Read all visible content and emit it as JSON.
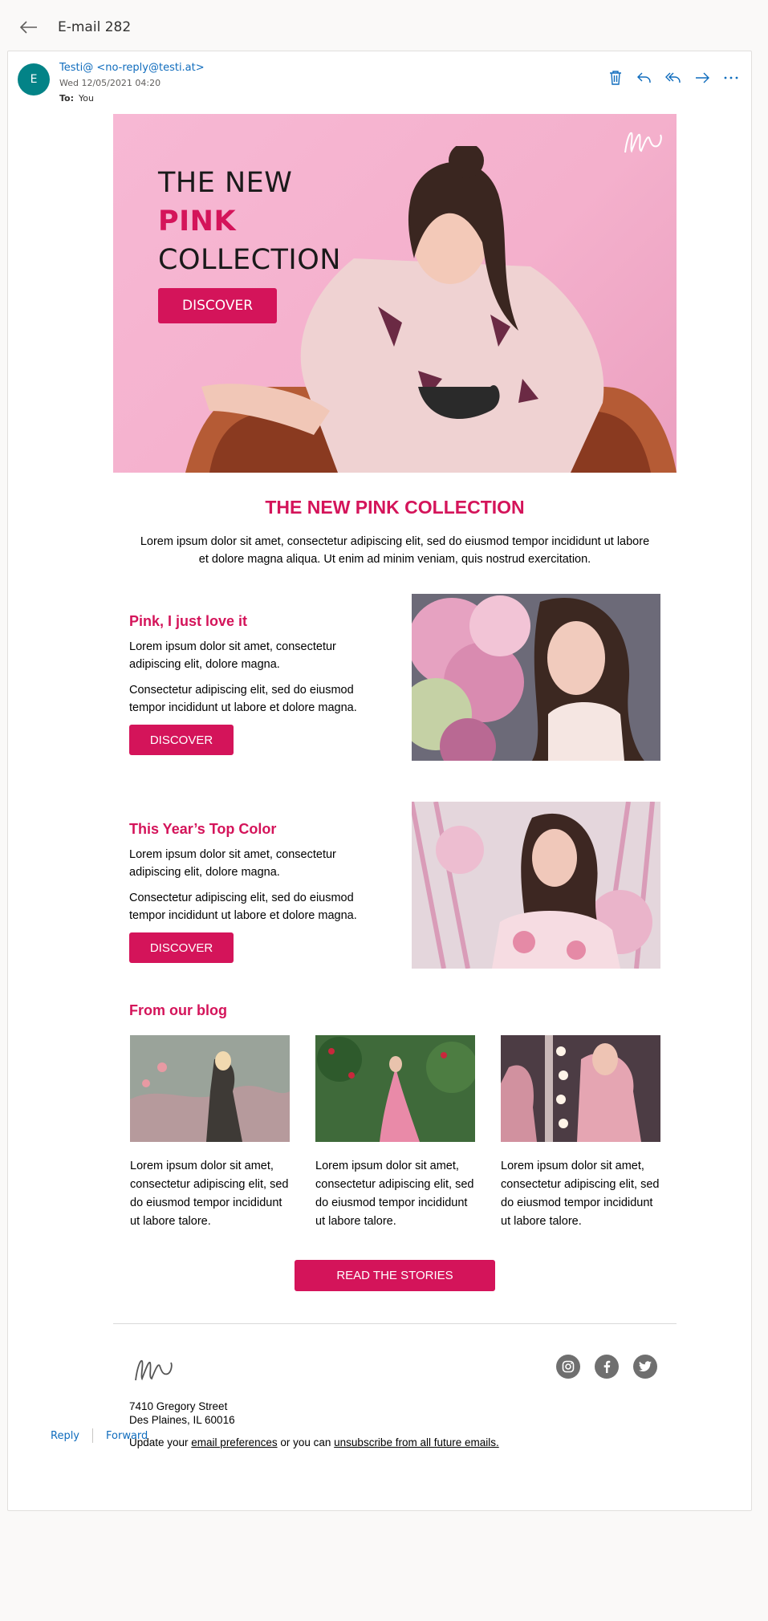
{
  "header": {
    "subject": "E-mail 282"
  },
  "message": {
    "avatar_initial": "E",
    "sender": "Testi@ <no-reply@testi.at>",
    "date": "Wed 12/05/2021 04:20",
    "to_label": "To:",
    "to_value": "You"
  },
  "actions": [
    "delete-icon",
    "reply-icon",
    "reply-all-icon",
    "forward-icon",
    "more-icon"
  ],
  "hero": {
    "line1": "THE NEW",
    "line2": "PINK",
    "line3": "COLLECTION",
    "button": "DISCOVER"
  },
  "headline": "THE NEW PINK COLLECTION",
  "intro": "Lorem ipsum dolor sit amet, consectetur adipiscing elit, sed do eiusmod tempor incididunt ut labore et dolore magna aliqua. Ut enim ad minim veniam, quis nostrud exercitation.",
  "features": [
    {
      "title": "Pink, I just love it",
      "p1": "Lorem ipsum dolor sit amet, consectetur adipiscing elit, dolore magna.",
      "p2": "Consectetur adipiscing elit, sed do eiusmod tempor incididunt ut labore et dolore magna.",
      "button": "DISCOVER"
    },
    {
      "title": "This Year’s Top Color",
      "p1": "Lorem ipsum dolor sit amet, consectetur adipiscing elit, dolore magna.",
      "p2": "Consectetur adipiscing elit, sed do eiusmod tempor incididunt ut labore et dolore magna.",
      "button": "DISCOVER"
    }
  ],
  "blog": {
    "title": "From our blog",
    "items": [
      "Lorem ipsum dolor sit amet, consectetur adipiscing elit, sed do eiusmod tempor incididunt ut labore talore.",
      "Lorem ipsum dolor sit amet, consectetur adipiscing elit, sed do eiusmod tempor incididunt ut labore talore.",
      "Lorem ipsum dolor sit amet, consectetur adipiscing elit, sed do eiusmod tempor incididunt ut labore talore."
    ],
    "button": "READ THE STORIES"
  },
  "footer": {
    "social": [
      "instagram-icon",
      "facebook-icon",
      "twitter-icon"
    ],
    "address1": "7410 Gregory Street",
    "address2": "Des Plaines, IL 60016",
    "prefs_pre": "Update your ",
    "prefs_link": "email preferences",
    "prefs_mid": " or you can ",
    "unsub_link": "unsubscribe from all future emails."
  },
  "reply_bar": {
    "reply": "Reply",
    "forward": "Forward"
  },
  "colors": {
    "accent": "#d4145a",
    "link": "#0f6cbd",
    "avatar": "#038387",
    "hero_bg": "#f7b8d4"
  }
}
